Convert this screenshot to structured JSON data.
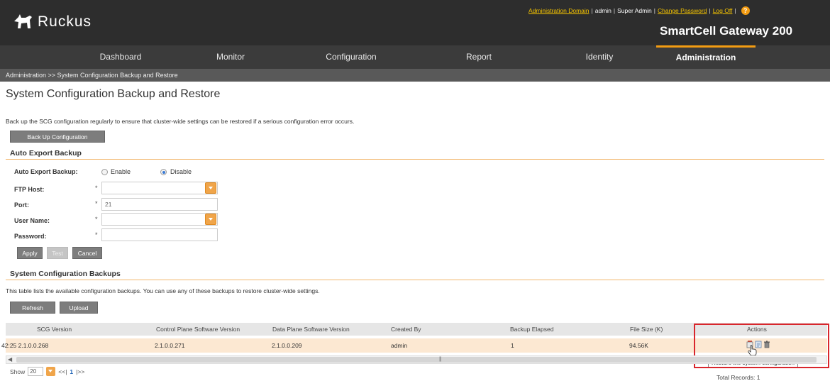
{
  "header": {
    "brand": "Ruckus",
    "links": {
      "domain": "Administration Domain",
      "user": "admin",
      "role": "Super Admin",
      "change_password": "Change Password",
      "logout": "Log Off"
    },
    "product": "SmartCell Gateway 200"
  },
  "nav": {
    "items": [
      "Dashboard",
      "Monitor",
      "Configuration",
      "Report",
      "Identity",
      "Administration"
    ],
    "active": "Administration"
  },
  "breadcrumb": "Administration  >>  System Configuration Backup and Restore",
  "page": {
    "title": "System Configuration Backup and Restore",
    "description": "Back up the SCG configuration regularly to ensure that cluster-wide settings can be restored if a serious configuration error occurs.",
    "backup_button": "Back Up Configuration"
  },
  "auto_export": {
    "section_title": "Auto Export Backup",
    "label_auto": "Auto Export Backup:",
    "option_enable": "Enable",
    "option_disable": "Disable",
    "selected": "Disable",
    "label_ftp_host": "FTP Host:",
    "label_port": "Port:",
    "label_user": "User Name:",
    "label_password": "Password:",
    "required_mark": "*",
    "ftp_host_value": "",
    "port_value": "21",
    "user_value": "",
    "password_value": "",
    "apply": "Apply",
    "test": "Test",
    "cancel": "Cancel"
  },
  "backups": {
    "section_title": "System Configuration Backups",
    "description": "This table lists the available configuration backups. You can use any of these backups to restore cluster-wide settings.",
    "refresh": "Refresh",
    "upload": "Upload",
    "columns": [
      "SCG Version",
      "Control Plane Software Version",
      "Data Plane Software Version",
      "Created By",
      "Backup Elapsed",
      "File Size (K)",
      "Actions"
    ],
    "rows": [
      {
        "scg_version": "42:25  2.1.0.0.268",
        "cp_version": "2.1.0.0.271",
        "dp_version": "2.1.0.0.209",
        "created_by": "admin",
        "elapsed": "1",
        "size": "94.56K"
      }
    ],
    "tooltip": "Restore the system configuration",
    "actions_icons": [
      "restore-icon",
      "download-icon",
      "delete-icon"
    ]
  },
  "pager": {
    "show_label": "Show",
    "page_size": "20",
    "prev": "<<|",
    "current": "1",
    "next": "|>>",
    "total": "Total Records: 1"
  },
  "colors": {
    "accent": "#f39c12",
    "header_bg": "#2d2d2d",
    "row_highlight": "#fce8d2",
    "annotation": "#d9262c"
  }
}
